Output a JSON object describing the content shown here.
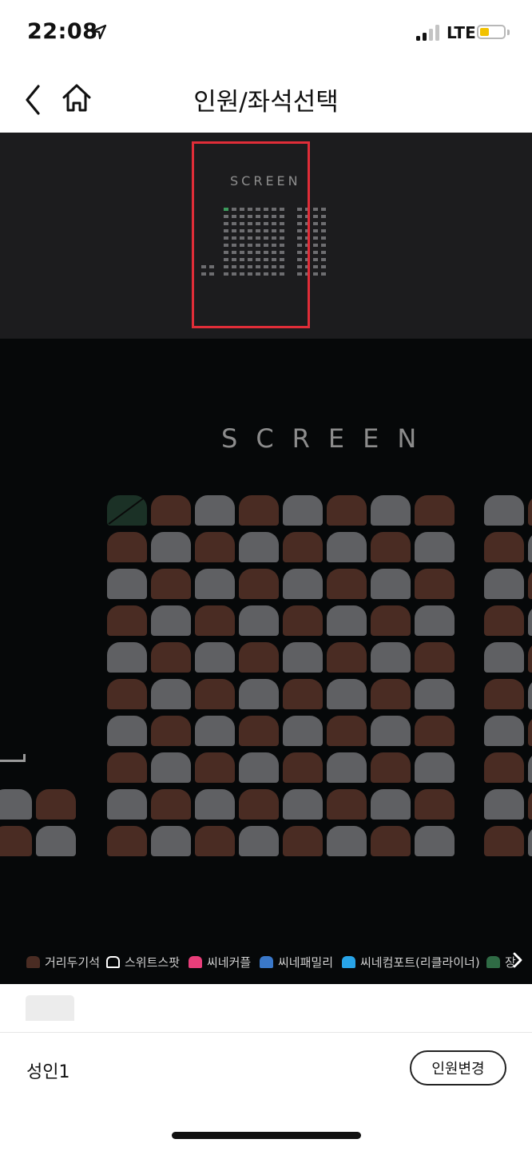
{
  "status_bar": {
    "time": "22:08",
    "network": "LTE",
    "location_icon": "location-arrow-icon",
    "signal_icon": "signal-bars-icon",
    "battery_icon": "battery-low-icon"
  },
  "nav": {
    "title": "인원/좌석선택",
    "back_icon": "chevron-left-icon",
    "home_icon": "home-icon"
  },
  "minimap": {
    "screen_label": "SCREEN",
    "frame_color": "#e02d38",
    "selected_seat_color": "#3c9a5c"
  },
  "seatmap": {
    "screen_label": "SCREEN",
    "colors": {
      "available": "#5f6063",
      "distancing": "#4a2c23",
      "selected": "#1b3126"
    },
    "rows": [
      "XDADADAD|AD",
      "DADADADA|DA",
      "ADADADAD|AD",
      "DADADADA|DA",
      "ADADADAD|AD",
      "DADADADA|DA",
      "ADADADAD|AD",
      "DADADADA|DA",
      "ADADADAD|AD",
      "DADADADA|DA"
    ],
    "left_block_rows": [
      "AD",
      "DA"
    ]
  },
  "legend": [
    {
      "label": "거리두기석",
      "color": "#4a2c23",
      "style": "fill"
    },
    {
      "label": "스위트스팟",
      "color": "#ffffff",
      "style": "outline"
    },
    {
      "label": "씨네커플",
      "color": "#e83e7a",
      "style": "fill"
    },
    {
      "label": "씨네패밀리",
      "color": "#3a78c9",
      "style": "fill"
    },
    {
      "label": "씨네컴포트(리클라이너)",
      "color": "#28a4e8",
      "style": "fill"
    },
    {
      "label": "장",
      "color": "#2f6b45",
      "style": "fill"
    }
  ],
  "legend_more_icon": "chevron-right-icon",
  "footer": {
    "person_count": "성인1",
    "change_button": "인원변경"
  }
}
